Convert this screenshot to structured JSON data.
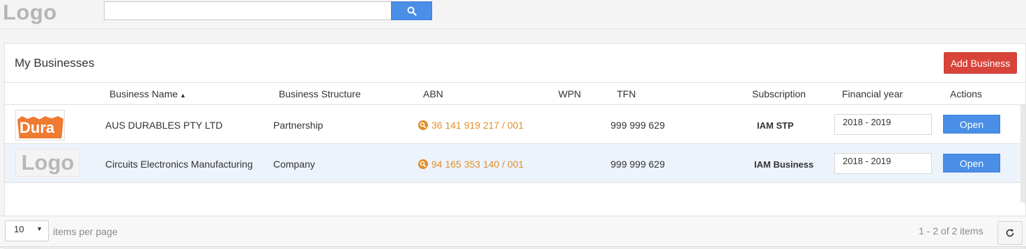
{
  "header": {
    "logo_text": "Logo",
    "search": {
      "placeholder": "",
      "value": "",
      "button_icon": "search-icon"
    }
  },
  "panel": {
    "title": "My Businesses",
    "add_button_label": "Add Business",
    "columns": [
      "Business Name",
      "Business Structure",
      "ABN",
      "WPN",
      "TFN",
      "Subscription",
      "Financial year",
      "Actions"
    ],
    "sort": {
      "column": "Business Name",
      "direction": "ascending"
    },
    "rows": [
      {
        "logo_text": "Dura",
        "name": "AUS DURABLES PTY LTD",
        "structure": "Partnership",
        "abn": "36 141 919 217 / 001",
        "wpn": "",
        "tfn": "999 999 629",
        "subscription": "IAM STP",
        "financial_year": "2018 - 2019",
        "action_label": "Open"
      },
      {
        "logo_text": "Logo",
        "name": "Circuits Electronics Manufacturing",
        "structure": "Company",
        "abn": "94 165 353 140 / 001",
        "wpn": "",
        "tfn": "999 999 629",
        "subscription": "IAM Business",
        "financial_year": "2018 - 2019",
        "action_label": "Open"
      }
    ]
  },
  "footer": {
    "page_size": "10",
    "per_page_label": "items per page",
    "item_count": "1 - 2 of 2 items",
    "refresh_icon": "refresh-icon"
  },
  "colors": {
    "primary_blue": "#4a8fe7",
    "danger_red": "#d9443a",
    "abn_orange": "#e08e2b",
    "row_highlight": "#edf3fb"
  }
}
